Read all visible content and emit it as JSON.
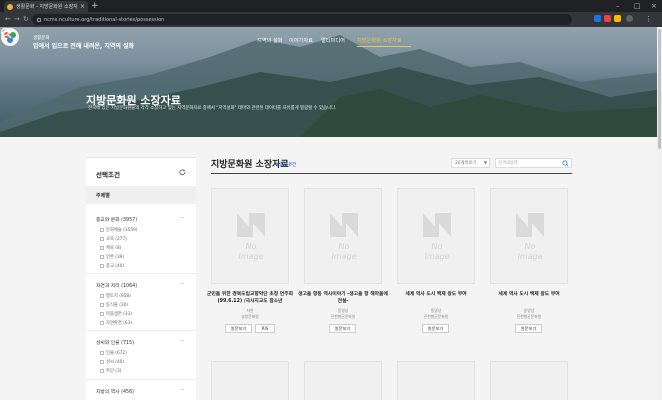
{
  "browser": {
    "tab_title": "생활문화 - 지방문화원 소장자료",
    "url": "ncms.nculture.org/traditional-stories/possession"
  },
  "header": {
    "site_sub": "생활문화",
    "site_title": "입에서 입으로 전해 내려온, 지역의 설화",
    "nav": [
      "지역의 설화",
      "이야기자료",
      "멀티미디어",
      "지방문화원 소장자료"
    ],
    "active_nav": "지방문화원 소장자료"
  },
  "hero": {
    "title": "지방문화원 소장자료",
    "desc": "전국에 있는 지방문화원들의 각각 소장하고 있는 지역문화자료 중에서 \"지역설화\" 테마와 관련된 데이터를 자유롭게 열람할 수 있습니다."
  },
  "sidebar": {
    "heading": "선택조건",
    "tab": "주제별",
    "groups": [
      {
        "title": "종교와 문화 (3957)",
        "toggle": "−",
        "options": [
          "문화예술 (3559)",
          "교육 (277)",
          "체육 (8)",
          "언론 (39)",
          "종교 (40)"
        ]
      },
      {
        "title": "자연과 지리 (1064)",
        "toggle": "−",
        "options": [
          "향토지 (958)",
          "동식물 (30)",
          "마을생존 (33)",
          "자연환경 (63)"
        ]
      },
      {
        "title": "성씨와 인물 (715)",
        "toggle": "−",
        "options": [
          "인물 (672)",
          "성씨 (40)",
          "주민 (3)"
        ]
      },
      {
        "title": "지방의 역사 (456)",
        "toggle": "−",
        "options": []
      }
    ]
  },
  "main": {
    "title": "지방문화원 소장자료",
    "count": "#9168건",
    "sort": "20개씩보기",
    "search_placeholder": "검색내용력",
    "no_image_text": "No image",
    "cards": [
      {
        "title": "군민을 위한 경북도립교향악단 초청 연주회(99.6.12) /국사지교도 참소년",
        "meta1": "자연",
        "meta2": "영양문화원",
        "buttons": [
          "원문보기",
          "RIS"
        ]
      },
      {
        "title": "생고을 향동 역사이야기 -생고을 향 해마을에 전설-",
        "meta1": "동영상",
        "meta2": "진천향군문화원",
        "buttons": [
          "원문보기"
        ]
      },
      {
        "title": "세계 역사 도시 백제 왕도 부여",
        "meta1": "동영상",
        "meta2": "진천향군문화원",
        "buttons": [
          "원문보기"
        ]
      },
      {
        "title": "세계 역사 도시 백제 왕도 부여",
        "meta1": "동영상",
        "meta2": "진천향군문화원",
        "buttons": [
          "원문보기"
        ]
      }
    ]
  }
}
